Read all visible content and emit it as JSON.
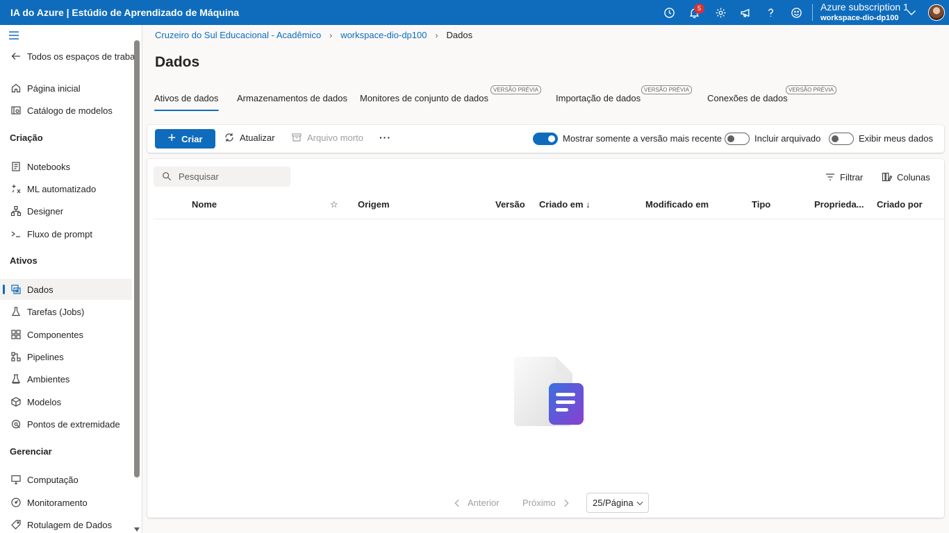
{
  "app_title": "IA do Azure | Estúdio de Aprendizado de Máquina",
  "topbar": {
    "notification_count": "5",
    "subscription": "Azure subscription 1",
    "workspace": "workspace-dio-dp100",
    "icons": [
      "history-icon",
      "bell-icon",
      "gear-icon",
      "megaphone-icon",
      "help-icon",
      "feedback-smiley-icon",
      "chevron-down-icon"
    ]
  },
  "sidebar": {
    "back_label": "Todos os espaços de trabal",
    "top_items": [
      {
        "label": "Página inicial",
        "icon": "home-icon"
      },
      {
        "label": "Catálogo de modelos",
        "icon": "catalog-icon"
      }
    ],
    "sections": [
      {
        "title": "Criação",
        "items": [
          {
            "label": "Notebooks",
            "icon": "notebook-icon"
          },
          {
            "label": "ML automatizado",
            "icon": "automl-icon"
          },
          {
            "label": "Designer",
            "icon": "designer-icon"
          },
          {
            "label": "Fluxo de prompt",
            "icon": "prompt-icon"
          }
        ]
      },
      {
        "title": "Ativos",
        "items": [
          {
            "label": "Dados",
            "icon": "data-icon",
            "active": true
          },
          {
            "label": "Tarefas (Jobs)",
            "icon": "flask-icon"
          },
          {
            "label": "Componentes",
            "icon": "components-icon"
          },
          {
            "label": "Pipelines",
            "icon": "pipelines-icon"
          },
          {
            "label": "Ambientes",
            "icon": "environments-icon"
          },
          {
            "label": "Modelos",
            "icon": "cube-icon"
          },
          {
            "label": "Pontos de extremidade",
            "icon": "endpoint-icon"
          }
        ]
      },
      {
        "title": "Gerenciar",
        "items": [
          {
            "label": "Computação",
            "icon": "compute-icon"
          },
          {
            "label": "Monitoramento",
            "icon": "monitor-icon"
          },
          {
            "label": "Rotulagem de Dados",
            "icon": "label-icon"
          }
        ]
      }
    ]
  },
  "breadcrumb": [
    "Cruzeiro do Sul Educacional - Acadêmico",
    "workspace-dio-dp100",
    "Dados"
  ],
  "page_title": "Dados",
  "tabs": [
    {
      "label": "Ativos de dados",
      "active": true
    },
    {
      "label": "Armazenamentos de dados"
    },
    {
      "label": "Monitores de conjunto de dados",
      "badge": "VERSÃO PRÉVIA"
    },
    {
      "label": "Importação de dados",
      "badge": "VERSÃO PRÉVIA"
    },
    {
      "label": "Conexões de dados",
      "badge": "VERSÃO PRÉVIA"
    }
  ],
  "toolbar": {
    "create": "Criar",
    "refresh": "Atualizar",
    "archive": "Arquivo morto",
    "more": "···",
    "toggles": [
      {
        "label": "Mostrar somente a versão mais recente",
        "on": true
      },
      {
        "label": "Incluir arquivado",
        "on": false
      },
      {
        "label": "Exibir meus dados",
        "on": false
      }
    ]
  },
  "table": {
    "search_placeholder": "Pesquisar",
    "filter": "Filtrar",
    "columns_button": "Colunas",
    "columns": [
      "Nome",
      "☆",
      "Origem",
      "Versão",
      "Criado em ↓",
      "Modificado em",
      "Tipo",
      "Proprieda...",
      "Criado por"
    ],
    "rows": []
  },
  "pagination": {
    "prev": "Anterior",
    "next": "Próximo",
    "page_size": "25/Página"
  }
}
